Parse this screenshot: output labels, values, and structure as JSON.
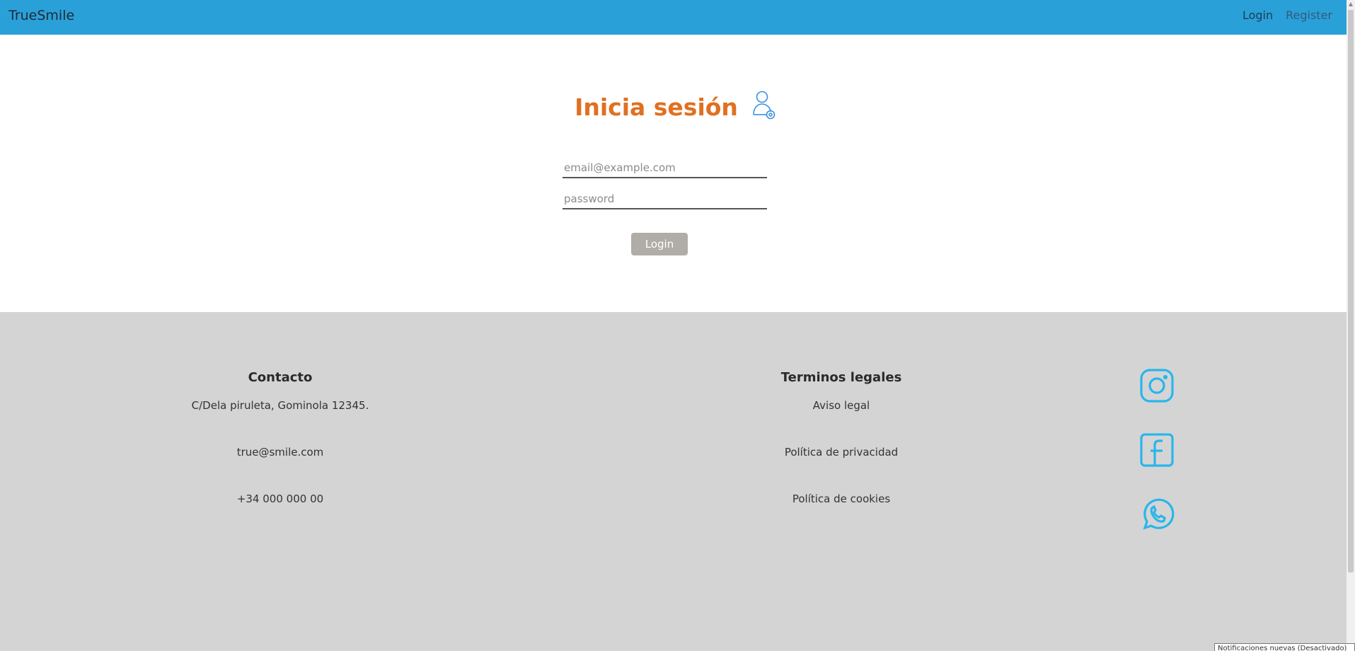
{
  "navbar": {
    "brand": "TrueSmile",
    "links": [
      {
        "label": "Login"
      },
      {
        "label": "Register"
      }
    ],
    "bg_color": "#2aa0d9"
  },
  "login": {
    "title": "Inicia sesión",
    "title_color": "#e07020",
    "icon": "user-key-icon",
    "email": {
      "placeholder": "email@example.com",
      "value": ""
    },
    "password": {
      "placeholder": "password",
      "value": ""
    },
    "button_label": "Login"
  },
  "footer": {
    "contact": {
      "title": "Contacto",
      "items": [
        "C/Dela piruleta, Gominola 12345.",
        "true@smile.com",
        "+34 000 000 00"
      ]
    },
    "legal": {
      "title": "Terminos legales",
      "items": [
        "Aviso legal",
        "Política de privacidad",
        "Política de cookies"
      ]
    },
    "social": [
      {
        "icon": "instagram-icon"
      },
      {
        "icon": "facebook-icon"
      },
      {
        "icon": "whatsapp-icon"
      }
    ],
    "icon_color": "#29b6ea"
  },
  "toast": {
    "text": "Notificaciones nuevas (Desactivado)"
  }
}
